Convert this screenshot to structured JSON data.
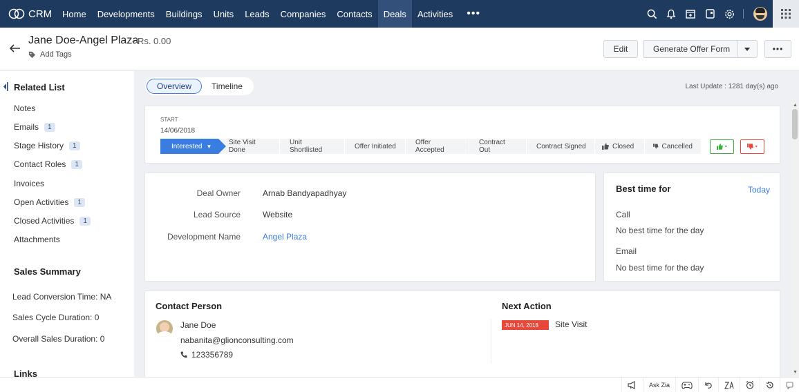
{
  "app": {
    "name": "CRM"
  },
  "nav": {
    "items": [
      {
        "label": "Home"
      },
      {
        "label": "Developments"
      },
      {
        "label": "Buildings"
      },
      {
        "label": "Units"
      },
      {
        "label": "Leads"
      },
      {
        "label": "Companies"
      },
      {
        "label": "Contacts"
      },
      {
        "label": "Deals",
        "active": true
      },
      {
        "label": "Activities"
      }
    ],
    "more": "•••",
    "icons": [
      "search-icon",
      "bell-icon",
      "calendar-add-icon",
      "tablet-icon",
      "gear-icon",
      "avatar",
      "apps-grid-icon"
    ]
  },
  "header": {
    "title": "Jane Doe-Angel Plaza",
    "amount": "- Rs. 0.00",
    "add_tags": "Add Tags",
    "edit_label": "Edit",
    "offer_label": "Generate Offer Form",
    "more_label": "•••"
  },
  "sidebar": {
    "related_title": "Related List",
    "related": [
      {
        "label": "Notes",
        "count": ""
      },
      {
        "label": "Emails",
        "count": "1"
      },
      {
        "label": "Stage History",
        "count": "1"
      },
      {
        "label": "Contact Roles",
        "count": "1"
      },
      {
        "label": "Invoices",
        "count": ""
      },
      {
        "label": "Open Activities",
        "count": "1"
      },
      {
        "label": "Closed Activities",
        "count": "1"
      },
      {
        "label": "Attachments",
        "count": ""
      }
    ],
    "summary_title": "Sales Summary",
    "summary": [
      {
        "label": "Lead Conversion Time: NA"
      },
      {
        "label": "Sales Cycle Duration: 0"
      },
      {
        "label": "Overall Sales Duration: 0"
      }
    ],
    "links_title": "Links"
  },
  "tabs": {
    "overview": "Overview",
    "timeline": "Timeline"
  },
  "last_update": "Last Update : 1281 day(s) ago",
  "stage": {
    "start_label": "START",
    "start_date": "14/06/2018",
    "current": "Interested",
    "stages": [
      "Interested",
      "Site Visit Done",
      "Unit Shortlisted",
      "Offer Initiated",
      "Offer Accepted",
      "Contract Out",
      "Contract Signed",
      "Closed",
      "Cancelled"
    ]
  },
  "fields": [
    {
      "label": "Deal Owner",
      "value": "Arnab Bandyapadhyay",
      "link": false
    },
    {
      "label": "Lead Source",
      "value": "Website",
      "link": false
    },
    {
      "label": "Development Name",
      "value": "Angel Plaza",
      "link": true
    }
  ],
  "best_time": {
    "title": "Best time for",
    "today": "Today",
    "call_label": "Call",
    "call_value": "No best time for the day",
    "email_label": "Email",
    "email_value": "No best time for the day"
  },
  "contact": {
    "title": "Contact Person",
    "name": "Jane Doe",
    "email": "nabanita@glionconsulting.com",
    "phone": "123356789"
  },
  "next_action": {
    "title": "Next Action",
    "date": "JUN 14, 2018",
    "text": "Site Visit"
  },
  "bottom_bar": {
    "ask_zia": "Ask Zia"
  },
  "colors": {
    "nav_bg": "#1e3a5f",
    "accent": "#3a7de0",
    "won": "#3cb043",
    "lost": "#e8483a"
  }
}
